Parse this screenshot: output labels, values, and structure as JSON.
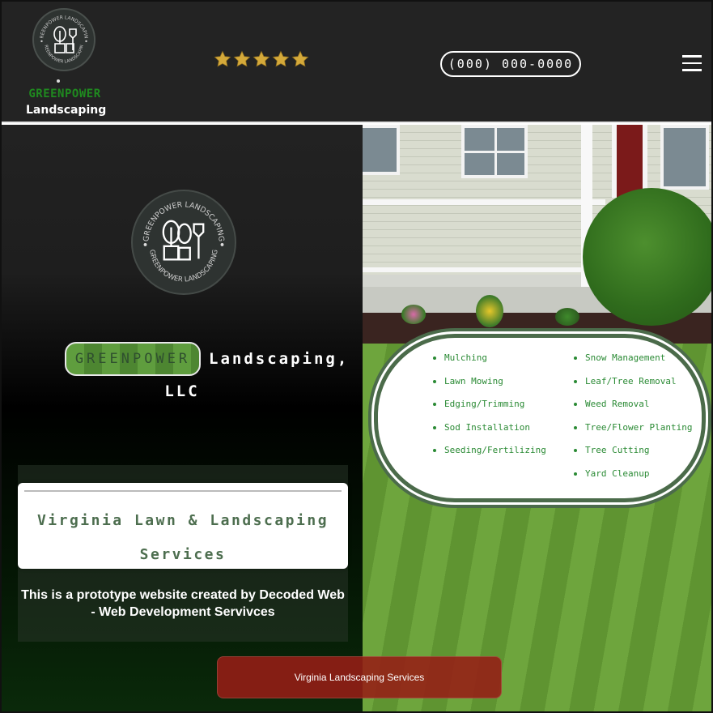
{
  "header": {
    "logo_ring_text_top": "GREENPOWER LANDSCAPING",
    "logo_ring_text_bottom": "GREENPOWER LANDSCAPING",
    "brand_green": "GREENPOWER",
    "brand_white": "Landscaping",
    "rating_stars": 5,
    "phone": "(000) 000-0000",
    "menu_icon": "hamburger-icon",
    "star_color": "#d4a93a"
  },
  "hero": {
    "logo_ring_text_top": "GREENPOWER LANDSCAPING",
    "logo_ring_text_bottom": "GREENPOWER LANDSCAPING",
    "title_pill": "GREENPOWER",
    "title_rest": "Landscaping,",
    "title_llc": "LLC",
    "service_heading": "Virginia Lawn & Landscaping Services",
    "prototype_note": "This is a prototype website created by Decoded Web - Web Development Servivces"
  },
  "services": {
    "column_a": [
      "Mulching",
      "Lawn Mowing",
      "Edging/Trimming",
      "Sod Installation",
      "Seeding/Fertilizing"
    ],
    "column_b": [
      "Snow Management",
      "Leaf/Tree Removal",
      "Weed Removal",
      "Tree/Flower Planting",
      "Tree Cutting",
      "Yard Cleanup"
    ]
  },
  "cta": {
    "label": "Virginia Landscaping Services",
    "color": "#961e16"
  },
  "colors": {
    "header_bg": "#232323",
    "brand_green": "#1f8a1f",
    "service_text": "#2a8a34",
    "oval_border": "#4b6b4a"
  }
}
